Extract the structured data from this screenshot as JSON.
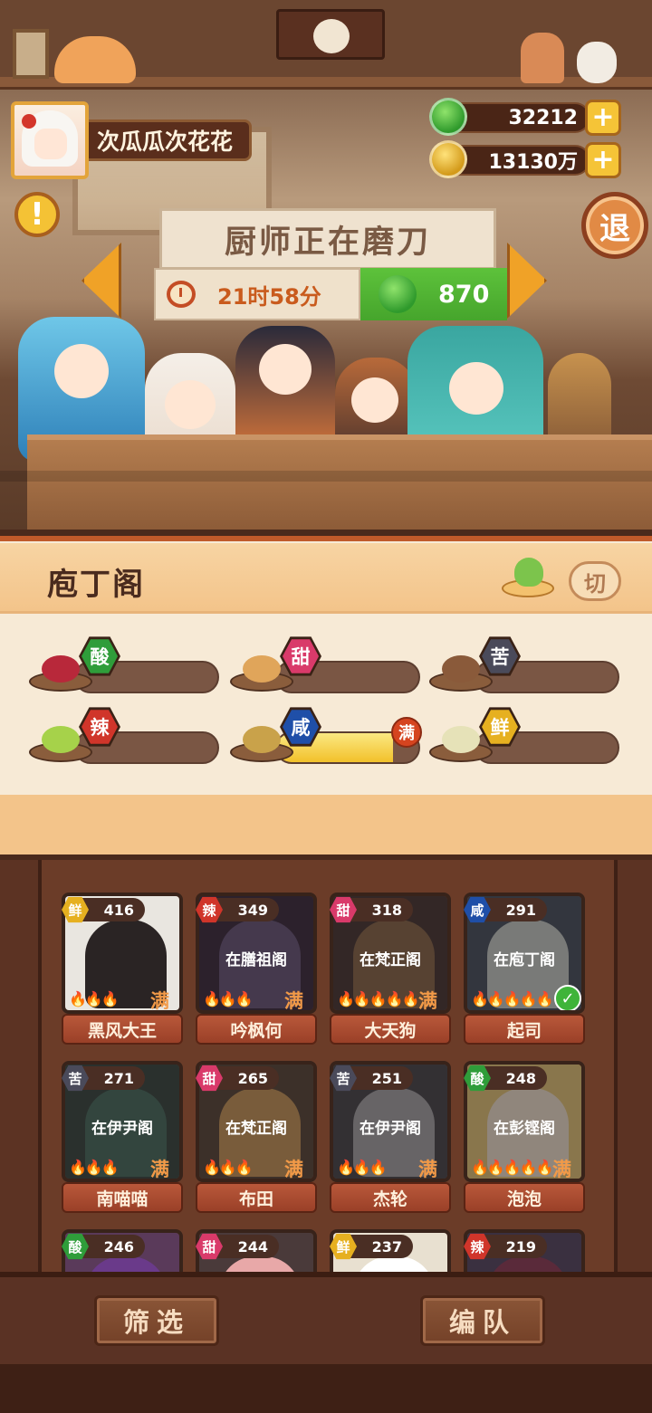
{
  "player": {
    "name": "次瓜瓜次花花"
  },
  "currency": [
    {
      "type": "jade",
      "value": "32212",
      "add_label": "+"
    },
    {
      "type": "coin",
      "value": "13130万",
      "add_label": "+"
    }
  ],
  "exit_label": "退",
  "status": {
    "title": "厨师正在磨刀",
    "time": "21时58分",
    "speedup_cost": "870"
  },
  "kitchen": {
    "name": "庖丁阁",
    "switch_label": "切",
    "flavors": [
      {
        "label": "酸",
        "color": "#2f9d3a",
        "progress": 0,
        "full_label": ""
      },
      {
        "label": "甜",
        "color": "#d93a6a",
        "progress": 0,
        "full_label": ""
      },
      {
        "label": "苦",
        "color": "#4a4a5a",
        "progress": 0,
        "full_label": ""
      },
      {
        "label": "辣",
        "color": "#d0352a",
        "progress": 0,
        "full_label": ""
      },
      {
        "label": "咸",
        "color": "#1f4fa8",
        "progress": 0.82,
        "full_label": "满"
      },
      {
        "label": "鲜",
        "color": "#e6b020",
        "progress": 0,
        "full_label": ""
      }
    ]
  },
  "chefs": [
    {
      "name": "黑风大王",
      "flavor": "鲜",
      "flavor_color": "#e6b020",
      "level": "416",
      "status": "",
      "flames": "🔥🔥🔥",
      "full": "满",
      "selected": false
    },
    {
      "name": "吟枫何",
      "flavor": "辣",
      "flavor_color": "#d0352a",
      "level": "349",
      "status": "在膳祖阁",
      "flames": "🔥🔥🔥",
      "full": "满",
      "selected": false
    },
    {
      "name": "大天狗",
      "flavor": "甜",
      "flavor_color": "#d93a6a",
      "level": "318",
      "status": "在梵正阁",
      "flames": "🔥🔥🔥🔥🔥",
      "full": "满",
      "selected": false
    },
    {
      "name": "起司",
      "flavor": "咸",
      "flavor_color": "#1f4fa8",
      "level": "291",
      "status": "在庖丁阁",
      "flames": "🔥🔥🔥🔥🔥",
      "full": "",
      "selected": true
    },
    {
      "name": "南喵喵",
      "flavor": "苦",
      "flavor_color": "#4a4a5a",
      "level": "271",
      "status": "在伊尹阁",
      "flames": "🔥🔥🔥",
      "full": "满",
      "selected": false
    },
    {
      "name": "布田",
      "flavor": "甜",
      "flavor_color": "#d93a6a",
      "level": "265",
      "status": "在梵正阁",
      "flames": "🔥🔥🔥",
      "full": "满",
      "selected": false
    },
    {
      "name": "杰轮",
      "flavor": "苦",
      "flavor_color": "#4a4a5a",
      "level": "251",
      "status": "在伊尹阁",
      "flames": "🔥🔥🔥",
      "full": "满",
      "selected": false
    },
    {
      "name": "泡泡",
      "flavor": "酸",
      "flavor_color": "#2f9d3a",
      "level": "248",
      "status": "在彭铿阁",
      "flames": "🔥🔥🔥🔥🔥",
      "full": "满",
      "selected": false
    },
    {
      "name": "",
      "flavor": "酸",
      "flavor_color": "#2f9d3a",
      "level": "246",
      "status": "",
      "flames": "",
      "full": "",
      "selected": false
    },
    {
      "name": "",
      "flavor": "甜",
      "flavor_color": "#d93a6a",
      "level": "244",
      "status": "",
      "flames": "",
      "full": "",
      "selected": false
    },
    {
      "name": "",
      "flavor": "鲜",
      "flavor_color": "#e6b020",
      "level": "237",
      "status": "",
      "flames": "",
      "full": "",
      "selected": false
    },
    {
      "name": "",
      "flavor": "辣",
      "flavor_color": "#d0352a",
      "level": "219",
      "status": "",
      "flames": "",
      "full": "",
      "selected": false
    }
  ],
  "bottom": {
    "filter_label": "筛选",
    "team_label": "编队"
  }
}
